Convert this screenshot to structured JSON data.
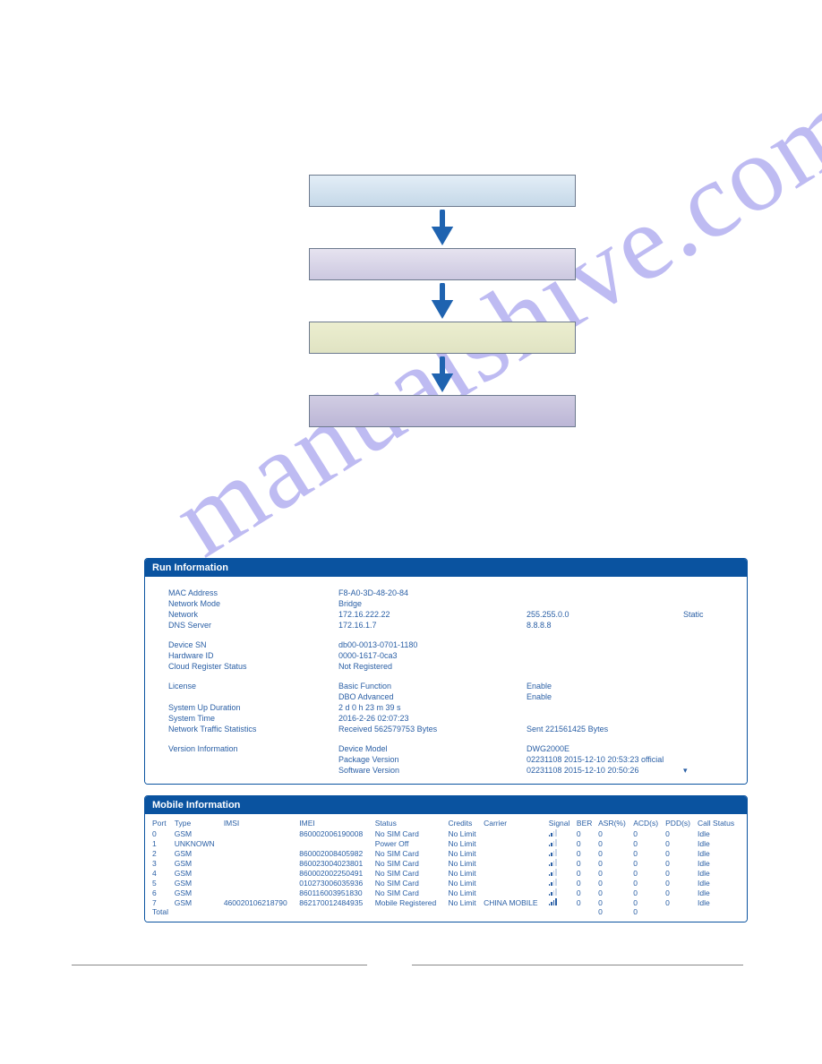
{
  "watermark": "manualshive.com",
  "runInfo": {
    "title": "Run Information",
    "rows": [
      {
        "label": "MAC Address",
        "v1": "F8-A0-3D-48-20-84",
        "v2": "",
        "v3": ""
      },
      {
        "label": "Network Mode",
        "v1": "Bridge",
        "v2": "",
        "v3": ""
      },
      {
        "label": "Network",
        "v1": "172.16.222.22",
        "v2": "255.255.0.0",
        "v3": "Static"
      },
      {
        "label": "DNS Server",
        "v1": "172.16.1.7",
        "v2": "8.8.8.8",
        "v3": ""
      },
      {
        "spacer": true
      },
      {
        "label": "Device SN",
        "v1": "db00-0013-0701-1180",
        "v2": "",
        "v3": ""
      },
      {
        "label": "Hardware ID",
        "v1": "0000-1617-0ca3",
        "v2": "",
        "v3": ""
      },
      {
        "label": "Cloud Register Status",
        "v1": "Not Registered",
        "v2": "",
        "v3": ""
      },
      {
        "spacer": true
      },
      {
        "label": "License",
        "v1": "Basic Function",
        "v2": "Enable",
        "v3": ""
      },
      {
        "label": "",
        "v1": "DBO Advanced",
        "v2": "Enable",
        "v3": ""
      },
      {
        "label": "System Up Duration",
        "v1": "2 d 0 h 23 m 39 s",
        "v2": "",
        "v3": ""
      },
      {
        "label": "System Time",
        "v1": "2016-2-26 02:07:23",
        "v2": "",
        "v3": ""
      },
      {
        "label": "Network Traffic Statistics",
        "v1": "Received 562579753 Bytes",
        "v2": "Sent 221561425 Bytes",
        "v3": ""
      },
      {
        "spacer": true
      },
      {
        "label": "Version Information",
        "v1": "Device Model",
        "v2": "DWG2000E",
        "v3": ""
      },
      {
        "label": "",
        "v1": "Package Version",
        "v2": "02231108 2015-12-10 20:53:23 official",
        "v3": ""
      },
      {
        "label": "",
        "v1": "Software Version",
        "v2": "02231108 2015-12-10 20:50:26",
        "v3": "▾"
      }
    ]
  },
  "mobileInfo": {
    "title": "Mobile Information",
    "headers": [
      "Port",
      "Type",
      "IMSI",
      "IMEI",
      "Status",
      "Credits",
      "Carrier",
      "Signal",
      "BER",
      "ASR(%)",
      "ACD(s)",
      "PDD(s)",
      "Call Status"
    ],
    "rows": [
      {
        "port": "0",
        "type": "GSM",
        "imsi": "",
        "imei": "860002006190008",
        "status": "No SIM Card",
        "credits": "No Limit",
        "carrier": "",
        "sig": "low",
        "ber": "0",
        "asr": "0",
        "acd": "0",
        "pdd": "0",
        "cs": "Idle"
      },
      {
        "port": "1",
        "type": "UNKNOWN",
        "imsi": "",
        "imei": "",
        "status": "Power Off",
        "credits": "No Limit",
        "carrier": "",
        "sig": "low",
        "ber": "0",
        "asr": "0",
        "acd": "0",
        "pdd": "0",
        "cs": "Idle"
      },
      {
        "port": "2",
        "type": "GSM",
        "imsi": "",
        "imei": "860002008405982",
        "status": "No SIM Card",
        "credits": "No Limit",
        "carrier": "",
        "sig": "low",
        "ber": "0",
        "asr": "0",
        "acd": "0",
        "pdd": "0",
        "cs": "Idle"
      },
      {
        "port": "3",
        "type": "GSM",
        "imsi": "",
        "imei": "860023004023801",
        "status": "No SIM Card",
        "credits": "No Limit",
        "carrier": "",
        "sig": "low",
        "ber": "0",
        "asr": "0",
        "acd": "0",
        "pdd": "0",
        "cs": "Idle"
      },
      {
        "port": "4",
        "type": "GSM",
        "imsi": "",
        "imei": "860002002250491",
        "status": "No SIM Card",
        "credits": "No Limit",
        "carrier": "",
        "sig": "low",
        "ber": "0",
        "asr": "0",
        "acd": "0",
        "pdd": "0",
        "cs": "Idle"
      },
      {
        "port": "5",
        "type": "GSM",
        "imsi": "",
        "imei": "010273006035936",
        "status": "No SIM Card",
        "credits": "No Limit",
        "carrier": "",
        "sig": "low",
        "ber": "0",
        "asr": "0",
        "acd": "0",
        "pdd": "0",
        "cs": "Idle"
      },
      {
        "port": "6",
        "type": "GSM",
        "imsi": "",
        "imei": "860116003951830",
        "status": "No SIM Card",
        "credits": "No Limit",
        "carrier": "",
        "sig": "low",
        "ber": "0",
        "asr": "0",
        "acd": "0",
        "pdd": "0",
        "cs": "Idle"
      },
      {
        "port": "7",
        "type": "GSM",
        "imsi": "460020106218790",
        "imei": "862170012484935",
        "status": "Mobile Registered",
        "credits": "No Limit",
        "carrier": "CHINA MOBILE",
        "sig": "full",
        "ber": "0",
        "asr": "0",
        "acd": "0",
        "pdd": "0",
        "cs": "Idle"
      }
    ],
    "totalLabel": "Total",
    "total": {
      "asr": "0",
      "acd": "0"
    }
  }
}
